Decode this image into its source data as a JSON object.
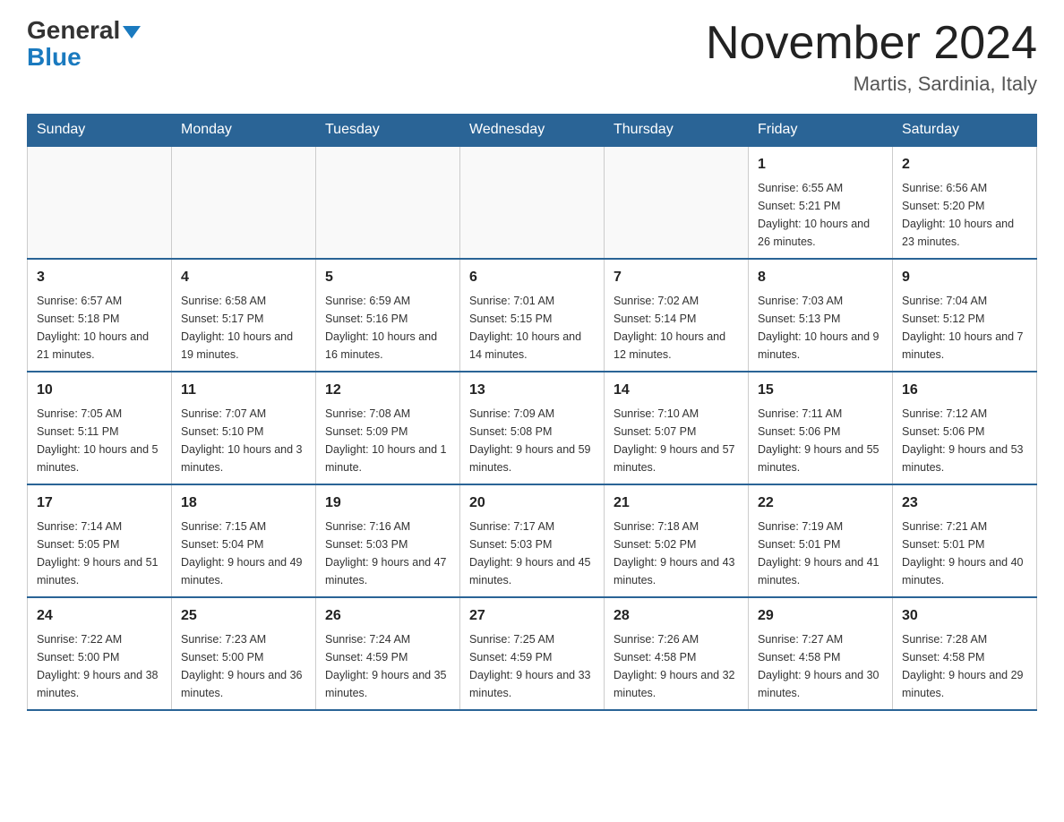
{
  "header": {
    "logo_general": "General",
    "logo_blue": "Blue",
    "month_title": "November 2024",
    "location": "Martis, Sardinia, Italy"
  },
  "days_of_week": [
    "Sunday",
    "Monday",
    "Tuesday",
    "Wednesday",
    "Thursday",
    "Friday",
    "Saturday"
  ],
  "weeks": [
    [
      {
        "day": "",
        "sunrise": "",
        "sunset": "",
        "daylight": ""
      },
      {
        "day": "",
        "sunrise": "",
        "sunset": "",
        "daylight": ""
      },
      {
        "day": "",
        "sunrise": "",
        "sunset": "",
        "daylight": ""
      },
      {
        "day": "",
        "sunrise": "",
        "sunset": "",
        "daylight": ""
      },
      {
        "day": "",
        "sunrise": "",
        "sunset": "",
        "daylight": ""
      },
      {
        "day": "1",
        "sunrise": "Sunrise: 6:55 AM",
        "sunset": "Sunset: 5:21 PM",
        "daylight": "Daylight: 10 hours and 26 minutes."
      },
      {
        "day": "2",
        "sunrise": "Sunrise: 6:56 AM",
        "sunset": "Sunset: 5:20 PM",
        "daylight": "Daylight: 10 hours and 23 minutes."
      }
    ],
    [
      {
        "day": "3",
        "sunrise": "Sunrise: 6:57 AM",
        "sunset": "Sunset: 5:18 PM",
        "daylight": "Daylight: 10 hours and 21 minutes."
      },
      {
        "day": "4",
        "sunrise": "Sunrise: 6:58 AM",
        "sunset": "Sunset: 5:17 PM",
        "daylight": "Daylight: 10 hours and 19 minutes."
      },
      {
        "day": "5",
        "sunrise": "Sunrise: 6:59 AM",
        "sunset": "Sunset: 5:16 PM",
        "daylight": "Daylight: 10 hours and 16 minutes."
      },
      {
        "day": "6",
        "sunrise": "Sunrise: 7:01 AM",
        "sunset": "Sunset: 5:15 PM",
        "daylight": "Daylight: 10 hours and 14 minutes."
      },
      {
        "day": "7",
        "sunrise": "Sunrise: 7:02 AM",
        "sunset": "Sunset: 5:14 PM",
        "daylight": "Daylight: 10 hours and 12 minutes."
      },
      {
        "day": "8",
        "sunrise": "Sunrise: 7:03 AM",
        "sunset": "Sunset: 5:13 PM",
        "daylight": "Daylight: 10 hours and 9 minutes."
      },
      {
        "day": "9",
        "sunrise": "Sunrise: 7:04 AM",
        "sunset": "Sunset: 5:12 PM",
        "daylight": "Daylight: 10 hours and 7 minutes."
      }
    ],
    [
      {
        "day": "10",
        "sunrise": "Sunrise: 7:05 AM",
        "sunset": "Sunset: 5:11 PM",
        "daylight": "Daylight: 10 hours and 5 minutes."
      },
      {
        "day": "11",
        "sunrise": "Sunrise: 7:07 AM",
        "sunset": "Sunset: 5:10 PM",
        "daylight": "Daylight: 10 hours and 3 minutes."
      },
      {
        "day": "12",
        "sunrise": "Sunrise: 7:08 AM",
        "sunset": "Sunset: 5:09 PM",
        "daylight": "Daylight: 10 hours and 1 minute."
      },
      {
        "day": "13",
        "sunrise": "Sunrise: 7:09 AM",
        "sunset": "Sunset: 5:08 PM",
        "daylight": "Daylight: 9 hours and 59 minutes."
      },
      {
        "day": "14",
        "sunrise": "Sunrise: 7:10 AM",
        "sunset": "Sunset: 5:07 PM",
        "daylight": "Daylight: 9 hours and 57 minutes."
      },
      {
        "day": "15",
        "sunrise": "Sunrise: 7:11 AM",
        "sunset": "Sunset: 5:06 PM",
        "daylight": "Daylight: 9 hours and 55 minutes."
      },
      {
        "day": "16",
        "sunrise": "Sunrise: 7:12 AM",
        "sunset": "Sunset: 5:06 PM",
        "daylight": "Daylight: 9 hours and 53 minutes."
      }
    ],
    [
      {
        "day": "17",
        "sunrise": "Sunrise: 7:14 AM",
        "sunset": "Sunset: 5:05 PM",
        "daylight": "Daylight: 9 hours and 51 minutes."
      },
      {
        "day": "18",
        "sunrise": "Sunrise: 7:15 AM",
        "sunset": "Sunset: 5:04 PM",
        "daylight": "Daylight: 9 hours and 49 minutes."
      },
      {
        "day": "19",
        "sunrise": "Sunrise: 7:16 AM",
        "sunset": "Sunset: 5:03 PM",
        "daylight": "Daylight: 9 hours and 47 minutes."
      },
      {
        "day": "20",
        "sunrise": "Sunrise: 7:17 AM",
        "sunset": "Sunset: 5:03 PM",
        "daylight": "Daylight: 9 hours and 45 minutes."
      },
      {
        "day": "21",
        "sunrise": "Sunrise: 7:18 AM",
        "sunset": "Sunset: 5:02 PM",
        "daylight": "Daylight: 9 hours and 43 minutes."
      },
      {
        "day": "22",
        "sunrise": "Sunrise: 7:19 AM",
        "sunset": "Sunset: 5:01 PM",
        "daylight": "Daylight: 9 hours and 41 minutes."
      },
      {
        "day": "23",
        "sunrise": "Sunrise: 7:21 AM",
        "sunset": "Sunset: 5:01 PM",
        "daylight": "Daylight: 9 hours and 40 minutes."
      }
    ],
    [
      {
        "day": "24",
        "sunrise": "Sunrise: 7:22 AM",
        "sunset": "Sunset: 5:00 PM",
        "daylight": "Daylight: 9 hours and 38 minutes."
      },
      {
        "day": "25",
        "sunrise": "Sunrise: 7:23 AM",
        "sunset": "Sunset: 5:00 PM",
        "daylight": "Daylight: 9 hours and 36 minutes."
      },
      {
        "day": "26",
        "sunrise": "Sunrise: 7:24 AM",
        "sunset": "Sunset: 4:59 PM",
        "daylight": "Daylight: 9 hours and 35 minutes."
      },
      {
        "day": "27",
        "sunrise": "Sunrise: 7:25 AM",
        "sunset": "Sunset: 4:59 PM",
        "daylight": "Daylight: 9 hours and 33 minutes."
      },
      {
        "day": "28",
        "sunrise": "Sunrise: 7:26 AM",
        "sunset": "Sunset: 4:58 PM",
        "daylight": "Daylight: 9 hours and 32 minutes."
      },
      {
        "day": "29",
        "sunrise": "Sunrise: 7:27 AM",
        "sunset": "Sunset: 4:58 PM",
        "daylight": "Daylight: 9 hours and 30 minutes."
      },
      {
        "day": "30",
        "sunrise": "Sunrise: 7:28 AM",
        "sunset": "Sunset: 4:58 PM",
        "daylight": "Daylight: 9 hours and 29 minutes."
      }
    ]
  ]
}
